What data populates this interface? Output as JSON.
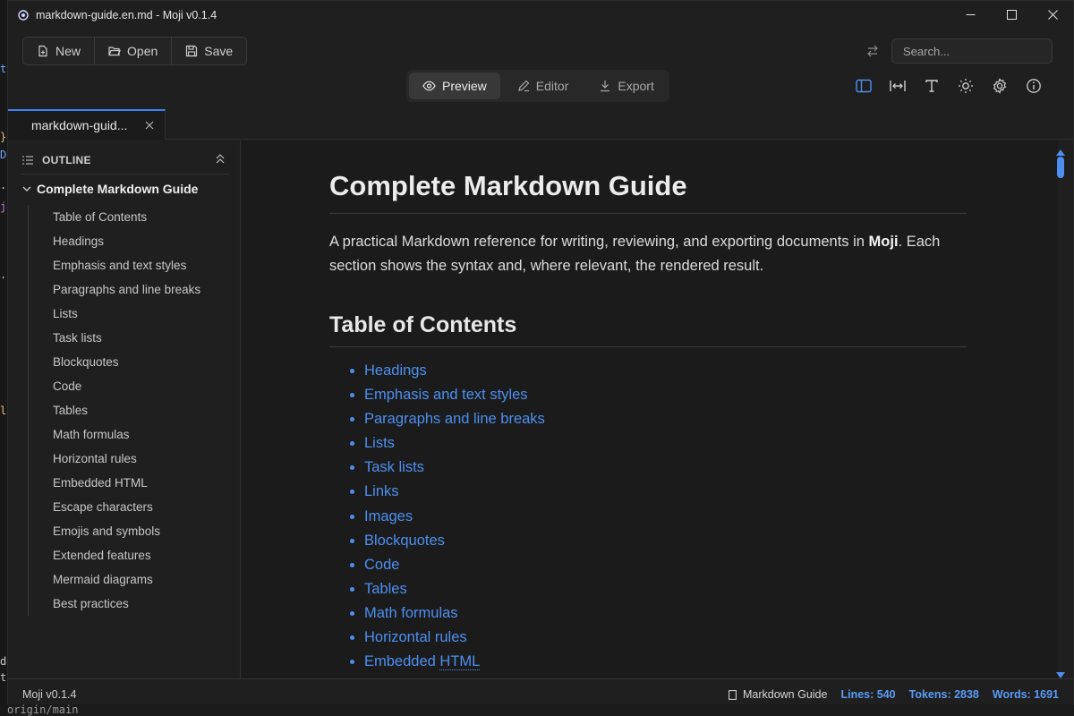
{
  "window": {
    "title": "markdown-guide.en.md - Moji v0.1.4"
  },
  "toolbar": {
    "new_label": "New",
    "open_label": "Open",
    "save_label": "Save",
    "search_placeholder": "Search..."
  },
  "modes": {
    "preview": "Preview",
    "editor": "Editor",
    "export": "Export",
    "active": "Preview"
  },
  "tab": {
    "label": "markdown-guid..."
  },
  "outline": {
    "heading": "OUTLINE",
    "root": "Complete Markdown Guide",
    "items": [
      "Table of Contents",
      "Headings",
      "Emphasis and text styles",
      "Paragraphs and line breaks",
      "Lists",
      "Task lists",
      "Blockquotes",
      "Code",
      "Tables",
      "Math formulas",
      "Horizontal rules",
      "Embedded HTML",
      "Escape characters",
      "Emojis and symbols",
      "Extended features",
      "Mermaid diagrams",
      "Best practices"
    ]
  },
  "document": {
    "h1": "Complete Markdown Guide",
    "intro_before": "A practical Markdown reference for writing, reviewing, and exporting documents in ",
    "intro_bold": "Moji",
    "intro_after": ". Each section shows the syntax and, where relevant, the rendered result.",
    "toc_heading": "Table of Contents",
    "toc": [
      "Headings",
      "Emphasis and text styles",
      "Paragraphs and line breaks",
      "Lists",
      "Task lists",
      "Links",
      "Images",
      "Blockquotes",
      "Code",
      "Tables",
      "Math formulas",
      "Horizontal rules"
    ],
    "toc_last_prefix": "Embedded ",
    "toc_last_abbr": "HTML"
  },
  "status": {
    "version": "Moji v0.1.4",
    "doc_name": "Markdown Guide",
    "lines": "Lines: 540",
    "tokens": "Tokens: 2838",
    "words": "Words: 1691"
  },
  "background": {
    "bottom_text": "origin/main"
  },
  "colors": {
    "accent": "#4d8ff0",
    "background": "#1b1b1b"
  }
}
